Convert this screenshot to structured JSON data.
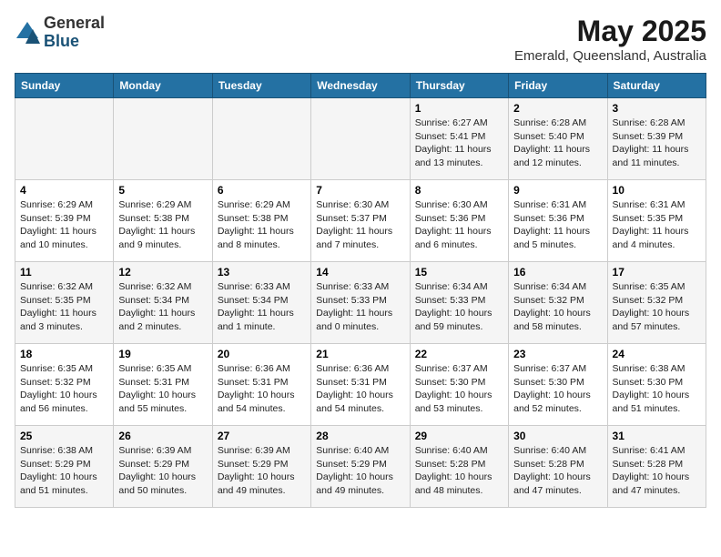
{
  "header": {
    "logo_general": "General",
    "logo_blue": "Blue",
    "month_year": "May 2025",
    "location": "Emerald, Queensland, Australia"
  },
  "weekdays": [
    "Sunday",
    "Monday",
    "Tuesday",
    "Wednesday",
    "Thursday",
    "Friday",
    "Saturday"
  ],
  "weeks": [
    [
      {
        "day": "",
        "info": ""
      },
      {
        "day": "",
        "info": ""
      },
      {
        "day": "",
        "info": ""
      },
      {
        "day": "",
        "info": ""
      },
      {
        "day": "1",
        "info": "Sunrise: 6:27 AM\nSunset: 5:41 PM\nDaylight: 11 hours\nand 13 minutes."
      },
      {
        "day": "2",
        "info": "Sunrise: 6:28 AM\nSunset: 5:40 PM\nDaylight: 11 hours\nand 12 minutes."
      },
      {
        "day": "3",
        "info": "Sunrise: 6:28 AM\nSunset: 5:39 PM\nDaylight: 11 hours\nand 11 minutes."
      }
    ],
    [
      {
        "day": "4",
        "info": "Sunrise: 6:29 AM\nSunset: 5:39 PM\nDaylight: 11 hours\nand 10 minutes."
      },
      {
        "day": "5",
        "info": "Sunrise: 6:29 AM\nSunset: 5:38 PM\nDaylight: 11 hours\nand 9 minutes."
      },
      {
        "day": "6",
        "info": "Sunrise: 6:29 AM\nSunset: 5:38 PM\nDaylight: 11 hours\nand 8 minutes."
      },
      {
        "day": "7",
        "info": "Sunrise: 6:30 AM\nSunset: 5:37 PM\nDaylight: 11 hours\nand 7 minutes."
      },
      {
        "day": "8",
        "info": "Sunrise: 6:30 AM\nSunset: 5:36 PM\nDaylight: 11 hours\nand 6 minutes."
      },
      {
        "day": "9",
        "info": "Sunrise: 6:31 AM\nSunset: 5:36 PM\nDaylight: 11 hours\nand 5 minutes."
      },
      {
        "day": "10",
        "info": "Sunrise: 6:31 AM\nSunset: 5:35 PM\nDaylight: 11 hours\nand 4 minutes."
      }
    ],
    [
      {
        "day": "11",
        "info": "Sunrise: 6:32 AM\nSunset: 5:35 PM\nDaylight: 11 hours\nand 3 minutes."
      },
      {
        "day": "12",
        "info": "Sunrise: 6:32 AM\nSunset: 5:34 PM\nDaylight: 11 hours\nand 2 minutes."
      },
      {
        "day": "13",
        "info": "Sunrise: 6:33 AM\nSunset: 5:34 PM\nDaylight: 11 hours\nand 1 minute."
      },
      {
        "day": "14",
        "info": "Sunrise: 6:33 AM\nSunset: 5:33 PM\nDaylight: 11 hours\nand 0 minutes."
      },
      {
        "day": "15",
        "info": "Sunrise: 6:34 AM\nSunset: 5:33 PM\nDaylight: 10 hours\nand 59 minutes."
      },
      {
        "day": "16",
        "info": "Sunrise: 6:34 AM\nSunset: 5:32 PM\nDaylight: 10 hours\nand 58 minutes."
      },
      {
        "day": "17",
        "info": "Sunrise: 6:35 AM\nSunset: 5:32 PM\nDaylight: 10 hours\nand 57 minutes."
      }
    ],
    [
      {
        "day": "18",
        "info": "Sunrise: 6:35 AM\nSunset: 5:32 PM\nDaylight: 10 hours\nand 56 minutes."
      },
      {
        "day": "19",
        "info": "Sunrise: 6:35 AM\nSunset: 5:31 PM\nDaylight: 10 hours\nand 55 minutes."
      },
      {
        "day": "20",
        "info": "Sunrise: 6:36 AM\nSunset: 5:31 PM\nDaylight: 10 hours\nand 54 minutes."
      },
      {
        "day": "21",
        "info": "Sunrise: 6:36 AM\nSunset: 5:31 PM\nDaylight: 10 hours\nand 54 minutes."
      },
      {
        "day": "22",
        "info": "Sunrise: 6:37 AM\nSunset: 5:30 PM\nDaylight: 10 hours\nand 53 minutes."
      },
      {
        "day": "23",
        "info": "Sunrise: 6:37 AM\nSunset: 5:30 PM\nDaylight: 10 hours\nand 52 minutes."
      },
      {
        "day": "24",
        "info": "Sunrise: 6:38 AM\nSunset: 5:30 PM\nDaylight: 10 hours\nand 51 minutes."
      }
    ],
    [
      {
        "day": "25",
        "info": "Sunrise: 6:38 AM\nSunset: 5:29 PM\nDaylight: 10 hours\nand 51 minutes."
      },
      {
        "day": "26",
        "info": "Sunrise: 6:39 AM\nSunset: 5:29 PM\nDaylight: 10 hours\nand 50 minutes."
      },
      {
        "day": "27",
        "info": "Sunrise: 6:39 AM\nSunset: 5:29 PM\nDaylight: 10 hours\nand 49 minutes."
      },
      {
        "day": "28",
        "info": "Sunrise: 6:40 AM\nSunset: 5:29 PM\nDaylight: 10 hours\nand 49 minutes."
      },
      {
        "day": "29",
        "info": "Sunrise: 6:40 AM\nSunset: 5:28 PM\nDaylight: 10 hours\nand 48 minutes."
      },
      {
        "day": "30",
        "info": "Sunrise: 6:40 AM\nSunset: 5:28 PM\nDaylight: 10 hours\nand 47 minutes."
      },
      {
        "day": "31",
        "info": "Sunrise: 6:41 AM\nSunset: 5:28 PM\nDaylight: 10 hours\nand 47 minutes."
      }
    ]
  ]
}
